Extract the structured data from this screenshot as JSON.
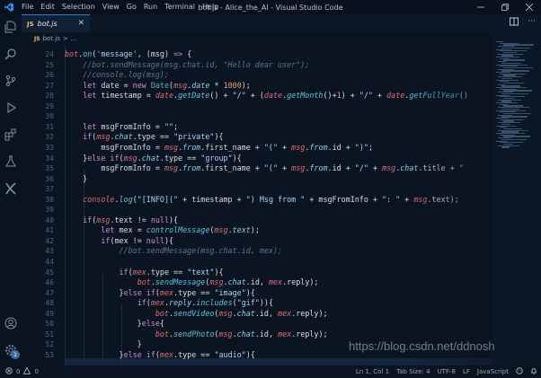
{
  "window": {
    "title": "bot.js - Alice_the_AI - Visual Studio Code",
    "menu": [
      "File",
      "Edit",
      "Selection",
      "View",
      "Go",
      "Run",
      "Terminal",
      "Help"
    ]
  },
  "tab": {
    "lang_badge": "JS",
    "label": "bot.js"
  },
  "breadcrumb": {
    "lang_badge": "JS",
    "file": "bot.js",
    "separator": ">",
    "trail": "..."
  },
  "editor": {
    "line_numbers": [
      "24",
      "25",
      "26",
      "27",
      "28",
      "29",
      "30",
      "31",
      "32",
      "33",
      "34",
      "35",
      "36",
      "37",
      "38",
      "39",
      "40",
      "41",
      "42",
      "43",
      "44",
      "45",
      "46",
      "47",
      "48",
      "49",
      "50",
      "51",
      "52",
      "53"
    ]
  },
  "statusbar": {
    "errors": "0",
    "warnings": "0",
    "position": "Ln 1, Col 1",
    "tab_size": "Tab Size: 4",
    "encoding": "UTF-8",
    "eol": "LF",
    "language": "JavaScript",
    "notifications_badge": "1"
  },
  "watermark": "https://blog.csdn.net/ddnosh",
  "colors": {
    "keyword": "#d58bd4",
    "function": "#5ec2e0",
    "string": "#a9d4ff",
    "number": "#f29e74",
    "comment": "#5a7690",
    "variable": "#e06c75",
    "accent": "#2b7fd0"
  }
}
